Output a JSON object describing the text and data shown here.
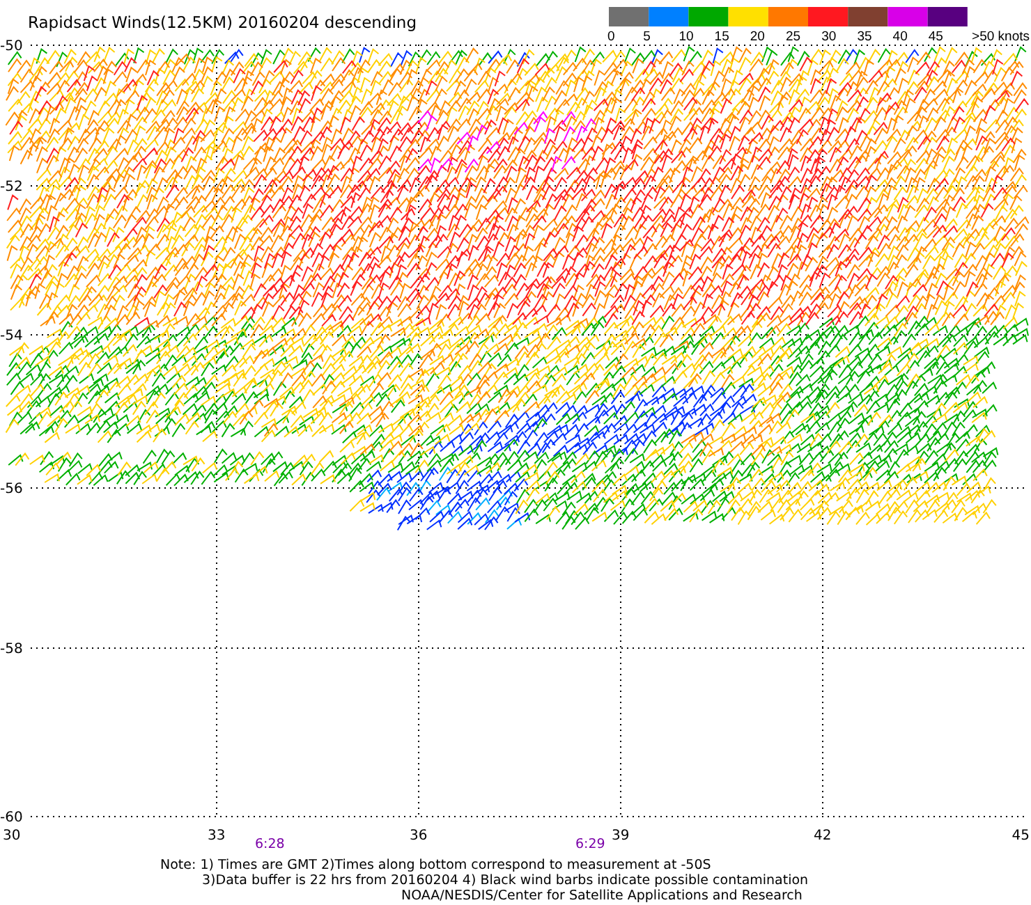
{
  "title": "Rapidsact Winds(12.5KM) 20160204 descending",
  "legend": {
    "swatches": [
      {
        "color": "#707070"
      },
      {
        "color": "#0080ff"
      },
      {
        "color": "#00a800"
      },
      {
        "color": "#ffe000"
      },
      {
        "color": "#ff7800"
      },
      {
        "color": "#ff1820"
      },
      {
        "color": "#804030"
      },
      {
        "color": "#d800e8"
      },
      {
        "color": "#580080"
      }
    ],
    "labels": [
      "0",
      "5",
      "10",
      "15",
      "20",
      "25",
      "30",
      "35",
      "40",
      "45",
      ">50 knots"
    ]
  },
  "y_axis_labels": [
    "-50",
    "-52",
    "-54",
    "-56",
    "-58",
    "-60"
  ],
  "x_axis_labels": [
    "30",
    "33",
    "36",
    "39",
    "42",
    "45"
  ],
  "time_labels": [
    "6:28",
    "6:29"
  ],
  "notes": [
    "Note: 1) Times are GMT 2)Times along bottom correspond to measurement at -50S",
    "3)Data buffer is 22 hrs from 20160204 4) Black wind barbs indicate possible contamination",
    "NOAA/NESDIS/Center for Satellite Applications and Research"
  ]
}
